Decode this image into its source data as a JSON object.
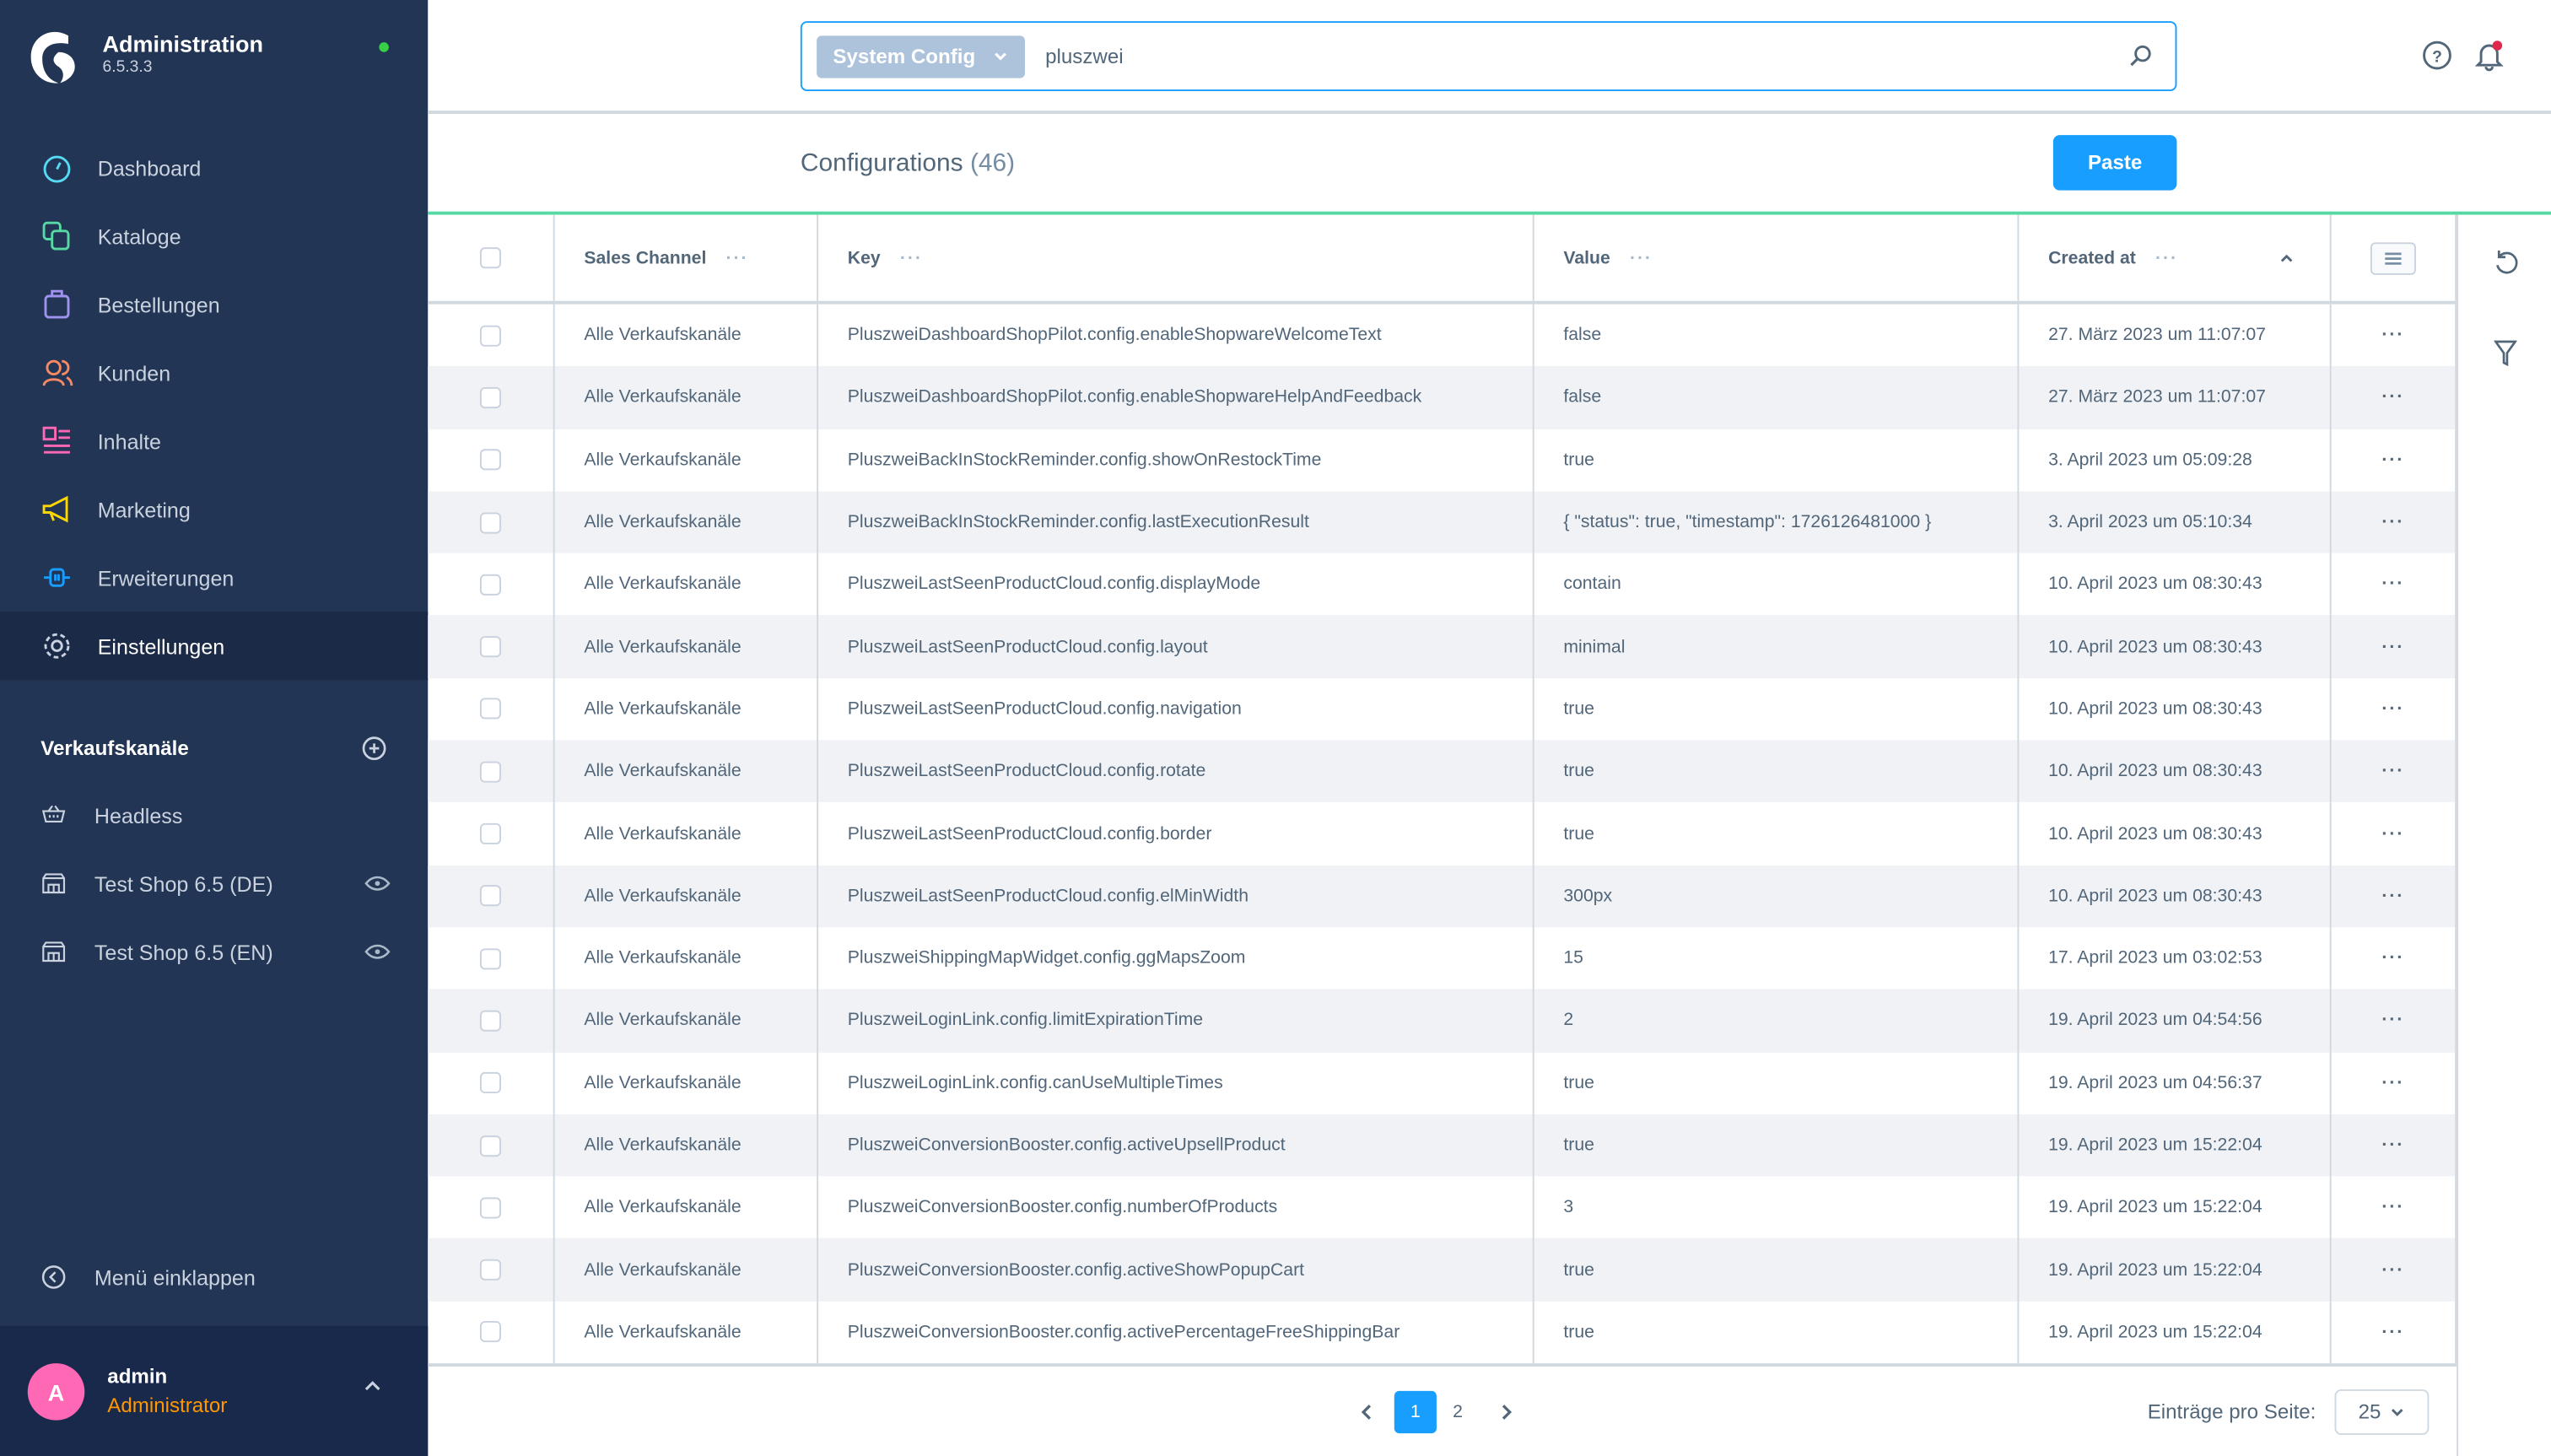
{
  "app": {
    "title": "Administration",
    "version": "6.5.3.3"
  },
  "colors": {
    "sidebar": "#233554",
    "accent": "#189eff",
    "status_online": "#37d046",
    "divider_green": "#57d9a3",
    "avatar": "#ff68b4",
    "role": "#ff9800"
  },
  "sidebar": {
    "items": [
      {
        "label": "Dashboard",
        "icon": "dashboard-icon"
      },
      {
        "label": "Kataloge",
        "icon": "catalog-icon"
      },
      {
        "label": "Bestellungen",
        "icon": "orders-icon"
      },
      {
        "label": "Kunden",
        "icon": "customers-icon"
      },
      {
        "label": "Inhalte",
        "icon": "content-icon"
      },
      {
        "label": "Marketing",
        "icon": "megaphone-icon"
      },
      {
        "label": "Erweiterungen",
        "icon": "plug-icon"
      },
      {
        "label": "Einstellungen",
        "icon": "gear-icon",
        "active": true
      }
    ],
    "sales_channels_title": "Verkaufskanäle",
    "sales_channels": [
      {
        "label": "Headless",
        "icon": "basket-icon"
      },
      {
        "label": "Test Shop 6.5 (DE)",
        "icon": "storefront-icon"
      },
      {
        "label": "Test Shop 6.5 (EN)",
        "icon": "storefront-icon"
      }
    ],
    "collapse_label": "Menü einklappen",
    "user": {
      "initial": "A",
      "name": "admin",
      "role": "Administrator"
    }
  },
  "search": {
    "type_label": "System Config",
    "value": "pluszwei"
  },
  "header": {
    "title": "Configurations",
    "count": "(46)",
    "paste_label": "Paste"
  },
  "table": {
    "columns": [
      "Sales Channel",
      "Key",
      "Value",
      "Created at"
    ],
    "sort": "ascending",
    "rows": [
      [
        "Alle Verkaufskanäle",
        "PluszweiDashboardShopPilot.config.enableShopwareWelcomeText",
        "false",
        "27. März 2023 um 11:07:07"
      ],
      [
        "Alle Verkaufskanäle",
        "PluszweiDashboardShopPilot.config.enableShopwareHelpAndFeedback",
        "false",
        "27. März 2023 um 11:07:07"
      ],
      [
        "Alle Verkaufskanäle",
        "PluszweiBackInStockReminder.config.showOnRestockTime",
        "true",
        "3. April 2023 um 05:09:28"
      ],
      [
        "Alle Verkaufskanäle",
        "PluszweiBackInStockReminder.config.lastExecutionResult",
        "{ \"status\": true, \"timestamp\": 1726126481000 }",
        "3. April 2023 um 05:10:34"
      ],
      [
        "Alle Verkaufskanäle",
        "PluszweiLastSeenProductCloud.config.displayMode",
        "contain",
        "10. April 2023 um 08:30:43"
      ],
      [
        "Alle Verkaufskanäle",
        "PluszweiLastSeenProductCloud.config.layout",
        "minimal",
        "10. April 2023 um 08:30:43"
      ],
      [
        "Alle Verkaufskanäle",
        "PluszweiLastSeenProductCloud.config.navigation",
        "true",
        "10. April 2023 um 08:30:43"
      ],
      [
        "Alle Verkaufskanäle",
        "PluszweiLastSeenProductCloud.config.rotate",
        "true",
        "10. April 2023 um 08:30:43"
      ],
      [
        "Alle Verkaufskanäle",
        "PluszweiLastSeenProductCloud.config.border",
        "true",
        "10. April 2023 um 08:30:43"
      ],
      [
        "Alle Verkaufskanäle",
        "PluszweiLastSeenProductCloud.config.elMinWidth",
        "300px",
        "10. April 2023 um 08:30:43"
      ],
      [
        "Alle Verkaufskanäle",
        "PluszweiShippingMapWidget.config.ggMapsZoom",
        "15",
        "17. April 2023 um 03:02:53"
      ],
      [
        "Alle Verkaufskanäle",
        "PluszweiLoginLink.config.limitExpirationTime",
        "2",
        "19. April 2023 um 04:54:56"
      ],
      [
        "Alle Verkaufskanäle",
        "PluszweiLoginLink.config.canUseMultipleTimes",
        "true",
        "19. April 2023 um 04:56:37"
      ],
      [
        "Alle Verkaufskanäle",
        "PluszweiConversionBooster.config.activeUpsellProduct",
        "true",
        "19. April 2023 um 15:22:04"
      ],
      [
        "Alle Verkaufskanäle",
        "PluszweiConversionBooster.config.numberOfProducts",
        "3",
        "19. April 2023 um 15:22:04"
      ],
      [
        "Alle Verkaufskanäle",
        "PluszweiConversionBooster.config.activeShowPopupCart",
        "true",
        "19. April 2023 um 15:22:04"
      ],
      [
        "Alle Verkaufskanäle",
        "PluszweiConversionBooster.config.activePercentageFreeShippingBar",
        "true",
        "19. April 2023 um 15:22:04"
      ]
    ]
  },
  "pagination": {
    "pages": [
      "1",
      "2"
    ],
    "current": "1",
    "per_page_label": "Einträge pro Seite:",
    "per_page": "25"
  }
}
